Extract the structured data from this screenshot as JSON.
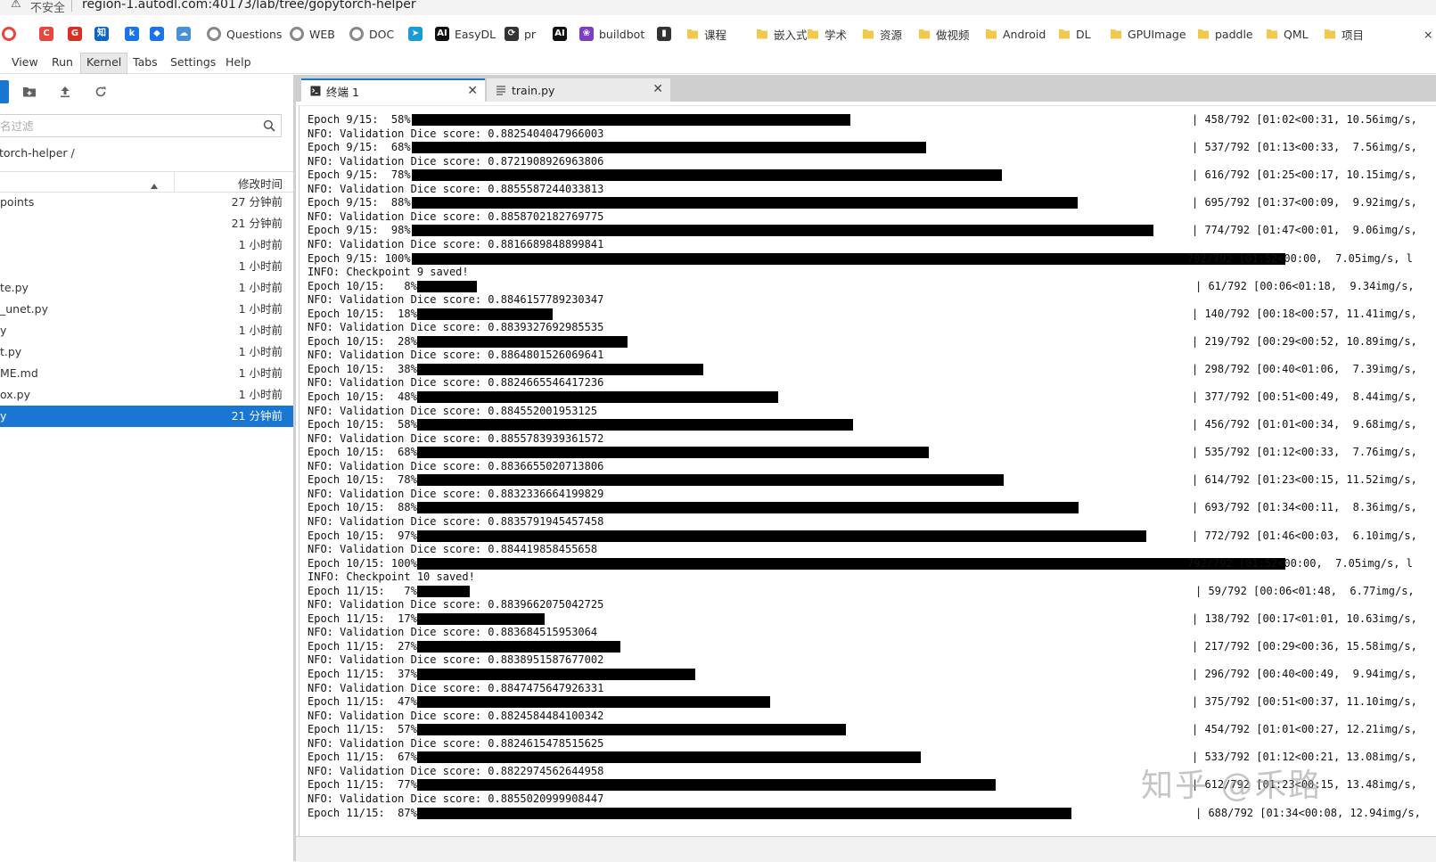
{
  "browser": {
    "insecure_label": "不安全",
    "url": "region-1.autodl.com:40173/lab/tree/gopytorch-helper",
    "bookmarks": [
      {
        "icon": "chrome-icon",
        "label": "",
        "color": "#e8453c"
      },
      {
        "icon": "c-icon",
        "label": "",
        "color": "#e8453c",
        "glyph": "C"
      },
      {
        "icon": "g-icon",
        "label": "",
        "color": "#d93025",
        "glyph": "G"
      },
      {
        "icon": "zhihu-icon",
        "label": "",
        "color": "#0a66c2",
        "glyph": "知"
      },
      {
        "icon": "k-icon",
        "label": "",
        "color": "#1a73e8",
        "glyph": "k"
      },
      {
        "icon": "shield-icon",
        "label": "",
        "color": "#1a73e8",
        "glyph": "◆"
      },
      {
        "icon": "cloud-icon",
        "label": "",
        "color": "#4a90d9",
        "glyph": "☁"
      },
      {
        "icon": "questions-icon",
        "label": "Questions",
        "color": "#888"
      },
      {
        "icon": "web-icon",
        "label": "WEB",
        "color": "#888"
      },
      {
        "icon": "doc-icon",
        "label": "DOC",
        "color": "#888"
      },
      {
        "icon": "paper-plane-icon",
        "label": "",
        "color": "#1a9bd7",
        "glyph": "➤"
      },
      {
        "icon": "ai-icon",
        "label": "EasyDL",
        "color": "#111",
        "glyph": "AI"
      },
      {
        "icon": "pr-icon",
        "label": "pr",
        "color": "#333",
        "glyph": "⟳"
      },
      {
        "icon": "ai-icon",
        "label": "",
        "color": "#111",
        "glyph": "AI"
      },
      {
        "icon": "buildbot-icon",
        "label": "buildbot",
        "color": "#7b3fbf",
        "glyph": "❀"
      },
      {
        "icon": "book-icon",
        "label": "",
        "color": "#333",
        "glyph": "▮"
      },
      {
        "icon": "folder-icon",
        "label": "课程"
      },
      {
        "icon": "folder-icon",
        "label": "嵌入式"
      },
      {
        "icon": "folder-icon",
        "label": "学术"
      },
      {
        "icon": "folder-icon",
        "label": "资源"
      },
      {
        "icon": "folder-icon",
        "label": "做视频"
      },
      {
        "icon": "folder-icon",
        "label": "Android"
      },
      {
        "icon": "folder-icon",
        "label": "DL"
      },
      {
        "icon": "folder-icon",
        "label": "GPUImage"
      },
      {
        "icon": "folder-icon",
        "label": "paddle"
      },
      {
        "icon": "folder-icon",
        "label": "QML"
      },
      {
        "icon": "folder-icon",
        "label": "项目"
      }
    ]
  },
  "menu": [
    "View",
    "Run",
    "Kernel",
    "Tabs",
    "Settings",
    "Help"
  ],
  "menu_active": "Kernel",
  "sidebar": {
    "filter_placeholder": "名过滤",
    "breadcrumb": "torch-helper /",
    "col_modified": "修改时间",
    "files": [
      {
        "name": "points",
        "time": "27 分钟前"
      },
      {
        "name": "",
        "time": "21 分钟前"
      },
      {
        "name": "",
        "time": "1 小时前"
      },
      {
        "name": "",
        "time": "1 小时前"
      },
      {
        "name": "te.py",
        "time": "1 小时前"
      },
      {
        "name": "_unet.py",
        "time": "1 小时前"
      },
      {
        "name": "y",
        "time": "1 小时前"
      },
      {
        "name": "t.py",
        "time": "1 小时前"
      },
      {
        "name": "ME.md",
        "time": "1 小时前"
      },
      {
        "name": "ox.py",
        "time": "1 小时前"
      },
      {
        "name": "y",
        "time": "21 分钟前",
        "selected": true
      }
    ]
  },
  "tabs": [
    {
      "label": "终端 1",
      "icon": "terminal-icon",
      "active": true
    },
    {
      "label": "train.py",
      "icon": "file-text-icon",
      "active": false
    }
  ],
  "terminal_lines": [
    {
      "text": "Epoch 9/15:  58%|",
      "bar": 58,
      "stats": "| 458/792 [01:02<00:31, 10.56img/s,"
    },
    {
      "text": "NFO: Validation Dice score: 0.8825404047966003"
    },
    {
      "text": "Epoch 9/15:  68%|",
      "bar": 68,
      "stats": "| 537/792 [01:13<00:33,  7.56img/s,"
    },
    {
      "text": "NFO: Validation Dice score: 0.8721908926963806"
    },
    {
      "text": "Epoch 9/15:  78%|",
      "bar": 78,
      "stats": "| 616/792 [01:25<00:17, 10.15img/s,"
    },
    {
      "text": "NFO: Validation Dice score: 0.8855587244033813"
    },
    {
      "text": "Epoch 9/15:  88%|",
      "bar": 88,
      "stats": "| 695/792 [01:37<00:09,  9.92img/s,"
    },
    {
      "text": "NFO: Validation Dice score: 0.8858702182769775"
    },
    {
      "text": "Epoch 9/15:  98%|",
      "bar": 98,
      "stats": "| 774/792 [01:47<00:01,  9.06img/s,"
    },
    {
      "text": "NFO: Validation Dice score: 0.8816689848899841"
    },
    {
      "text": "Epoch 9/15: 100%|",
      "bar": 100,
      "stats": "792/792 [01:52<00:00,  7.05img/s, l"
    },
    {
      "text": "INFO: Checkpoint 9 saved!"
    },
    {
      "text": "Epoch 10/15:   8%|",
      "bar": 8,
      "stats": "| 61/792 [00:06<01:18,  9.34img/s,"
    },
    {
      "text": "NFO: Validation Dice score: 0.8846157789230347"
    },
    {
      "text": "Epoch 10/15:  18%|",
      "bar": 18,
      "stats": "| 140/792 [00:18<00:57, 11.41img/s,"
    },
    {
      "text": "NFO: Validation Dice score: 0.8839327692985535"
    },
    {
      "text": "Epoch 10/15:  28%|",
      "bar": 28,
      "stats": "| 219/792 [00:29<00:52, 10.89img/s,"
    },
    {
      "text": "NFO: Validation Dice score: 0.8864801526069641"
    },
    {
      "text": "Epoch 10/15:  38%|",
      "bar": 38,
      "stats": "| 298/792 [00:40<01:06,  7.39img/s,"
    },
    {
      "text": "NFO: Validation Dice score: 0.8824665546417236"
    },
    {
      "text": "Epoch 10/15:  48%|",
      "bar": 48,
      "stats": "| 377/792 [00:51<00:49,  8.44img/s,"
    },
    {
      "text": "NFO: Validation Dice score: 0.884552001953125"
    },
    {
      "text": "Epoch 10/15:  58%|",
      "bar": 58,
      "stats": "| 456/792 [01:01<00:34,  9.68img/s,"
    },
    {
      "text": "NFO: Validation Dice score: 0.8855783939361572"
    },
    {
      "text": "Epoch 10/15:  68%|",
      "bar": 68,
      "stats": "| 535/792 [01:12<00:33,  7.76img/s,"
    },
    {
      "text": "NFO: Validation Dice score: 0.8836655020713806"
    },
    {
      "text": "Epoch 10/15:  78%|",
      "bar": 78,
      "stats": "| 614/792 [01:23<00:15, 11.52img/s,"
    },
    {
      "text": "NFO: Validation Dice score: 0.8832336664199829"
    },
    {
      "text": "Epoch 10/15:  88%|",
      "bar": 88,
      "stats": "| 693/792 [01:34<00:11,  8.36img/s,"
    },
    {
      "text": "NFO: Validation Dice score: 0.8835791945457458"
    },
    {
      "text": "Epoch 10/15:  97%|",
      "bar": 97,
      "stats": "| 772/792 [01:46<00:03,  6.10img/s,"
    },
    {
      "text": "NFO: Validation Dice score: 0.884419858455658"
    },
    {
      "text": "Epoch 10/15: 100%|",
      "bar": 100,
      "stats": "792/792 [01:52<00:00,  7.05img/s, l"
    },
    {
      "text": "INFO: Checkpoint 10 saved!"
    },
    {
      "text": "Epoch 11/15:   7%|",
      "bar": 7,
      "stats": "| 59/792 [00:06<01:48,  6.77img/s,"
    },
    {
      "text": "NFO: Validation Dice score: 0.8839662075042725"
    },
    {
      "text": "Epoch 11/15:  17%|",
      "bar": 17,
      "stats": "| 138/792 [00:17<01:01, 10.63img/s,"
    },
    {
      "text": "NFO: Validation Dice score: 0.883684515953064"
    },
    {
      "text": "Epoch 11/15:  27%|",
      "bar": 27,
      "stats": "| 217/792 [00:29<00:36, 15.58img/s,"
    },
    {
      "text": "NFO: Validation Dice score: 0.8838951587677002"
    },
    {
      "text": "Epoch 11/15:  37%|",
      "bar": 37,
      "stats": "| 296/792 [00:40<00:49,  9.94img/s,"
    },
    {
      "text": "NFO: Validation Dice score: 0.8847475647926331"
    },
    {
      "text": "Epoch 11/15:  47%|",
      "bar": 47,
      "stats": "| 375/792 [00:51<00:37, 11.10img/s,"
    },
    {
      "text": "NFO: Validation Dice score: 0.8824584484100342"
    },
    {
      "text": "Epoch 11/15:  57%|",
      "bar": 57,
      "stats": "| 454/792 [01:01<00:27, 12.21img/s,"
    },
    {
      "text": "NFO: Validation Dice score: 0.8824615478515625"
    },
    {
      "text": "Epoch 11/15:  67%|",
      "bar": 67,
      "stats": "| 533/792 [01:12<00:21, 13.08img/s,"
    },
    {
      "text": "NFO: Validation Dice score: 0.8822974562644958"
    },
    {
      "text": "Epoch 11/15:  77%|",
      "bar": 77,
      "stats": "| 612/792 [01:23<00:15, 13.48img/s,"
    },
    {
      "text": "NFO: Validation Dice score: 0.8855020999908447"
    },
    {
      "text": "Epoch 11/15:  87%|",
      "bar": 87,
      "stats": "| 688/792 [01:34<00:08, 12.94img/s,"
    }
  ],
  "watermark": "知乎 @禾路",
  "colors": {
    "accent": "#1976d2",
    "folder": "#f2c94c",
    "bar": "#000000"
  }
}
